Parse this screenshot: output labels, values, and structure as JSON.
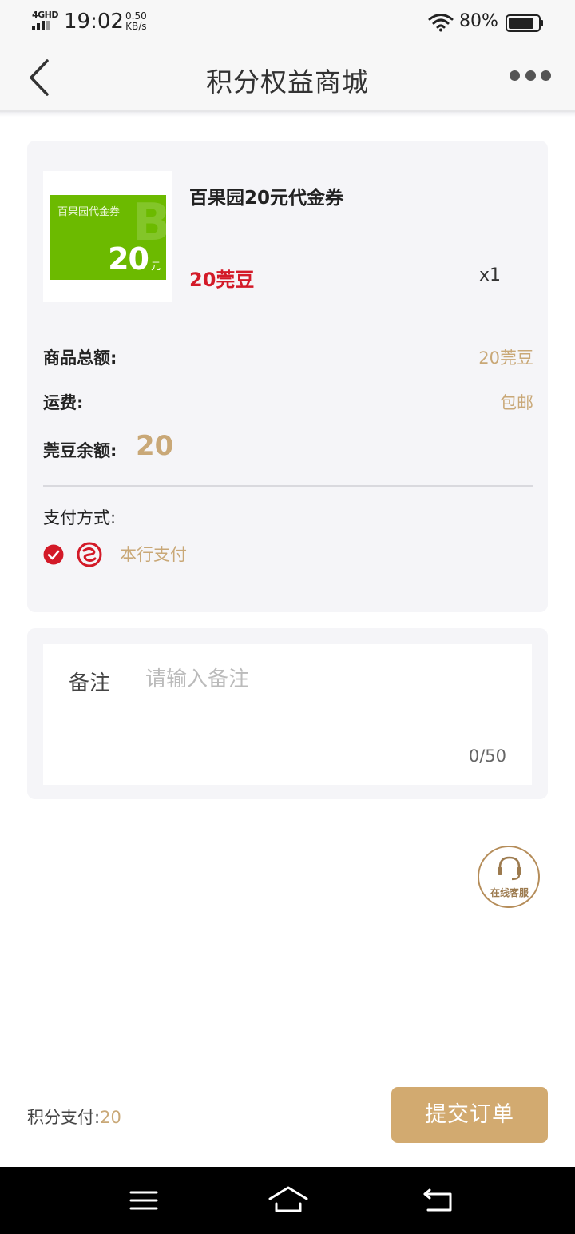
{
  "status_bar": {
    "network": "4GHD",
    "time": "19:02",
    "speed_value": "0.50",
    "speed_unit": "KB/s",
    "battery": "80%"
  },
  "nav": {
    "title": "积分权益商城",
    "back_icon": "chevron-left-icon",
    "more_icon": "more-dots-icon"
  },
  "product": {
    "name": "百果园20元代金券",
    "price": "20莞豆",
    "quantity": "x1",
    "image": {
      "label": "百果园代金券",
      "letter": "B",
      "amount": "20",
      "unit": "元",
      "color": "#6cba00"
    }
  },
  "summary": {
    "total_label": "商品总额:",
    "total_value": "20莞豆",
    "shipping_label": "运费:",
    "shipping_value": "包邮",
    "balance_label": "莞豆余额:",
    "balance_value": "20"
  },
  "payment": {
    "label": "支付方式:",
    "method": "本行支付",
    "selected": true
  },
  "remark": {
    "label": "备注",
    "placeholder": "请输入备注",
    "counter": "0/50"
  },
  "customer_service": {
    "label": "在线客服",
    "icon": "headset-icon"
  },
  "footer": {
    "points_label": "积分支付:",
    "points_value": "20",
    "submit_label": "提交订单"
  },
  "colors": {
    "accent_gold": "#c9a877",
    "submit_bg": "#d2aa70",
    "price_red": "#d31a28",
    "card_bg": "#f5f5f8"
  }
}
